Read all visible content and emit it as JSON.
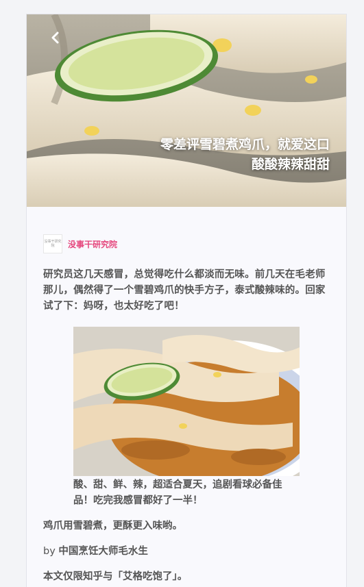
{
  "article": {
    "title_line1": "零差评雪碧煮鸡爪，就爱这口",
    "title_line2": "酸酸辣辣甜甜",
    "author": {
      "name": "没事干研究院",
      "avatar_text": "没事干研究院"
    },
    "intro": "研究员这几天感冒，总觉得吃什么都淡而无味。前几天在毛老师那儿，偶然得了一个雪碧鸡爪的快手方子，泰式酸辣味的。回家试了下：妈呀，也太好吃了吧！",
    "image_caption": "酸、甜、鲜、辣，超适合夏天，追剧看球必备佳品！吃完我感冒都好了一半！",
    "paragraph2": "鸡爪用雪碧煮，更酥更入味哟。",
    "byline_prefix": "by ",
    "byline_name": "中国烹饪大师毛水生",
    "notice": "本文仅限知乎与「艾格吃饱了」。"
  },
  "icons": {
    "back": "chevron-left-icon"
  },
  "colors": {
    "author_accent": "#e5477d",
    "body_text": "#555555",
    "background": "#f9f9fd"
  }
}
